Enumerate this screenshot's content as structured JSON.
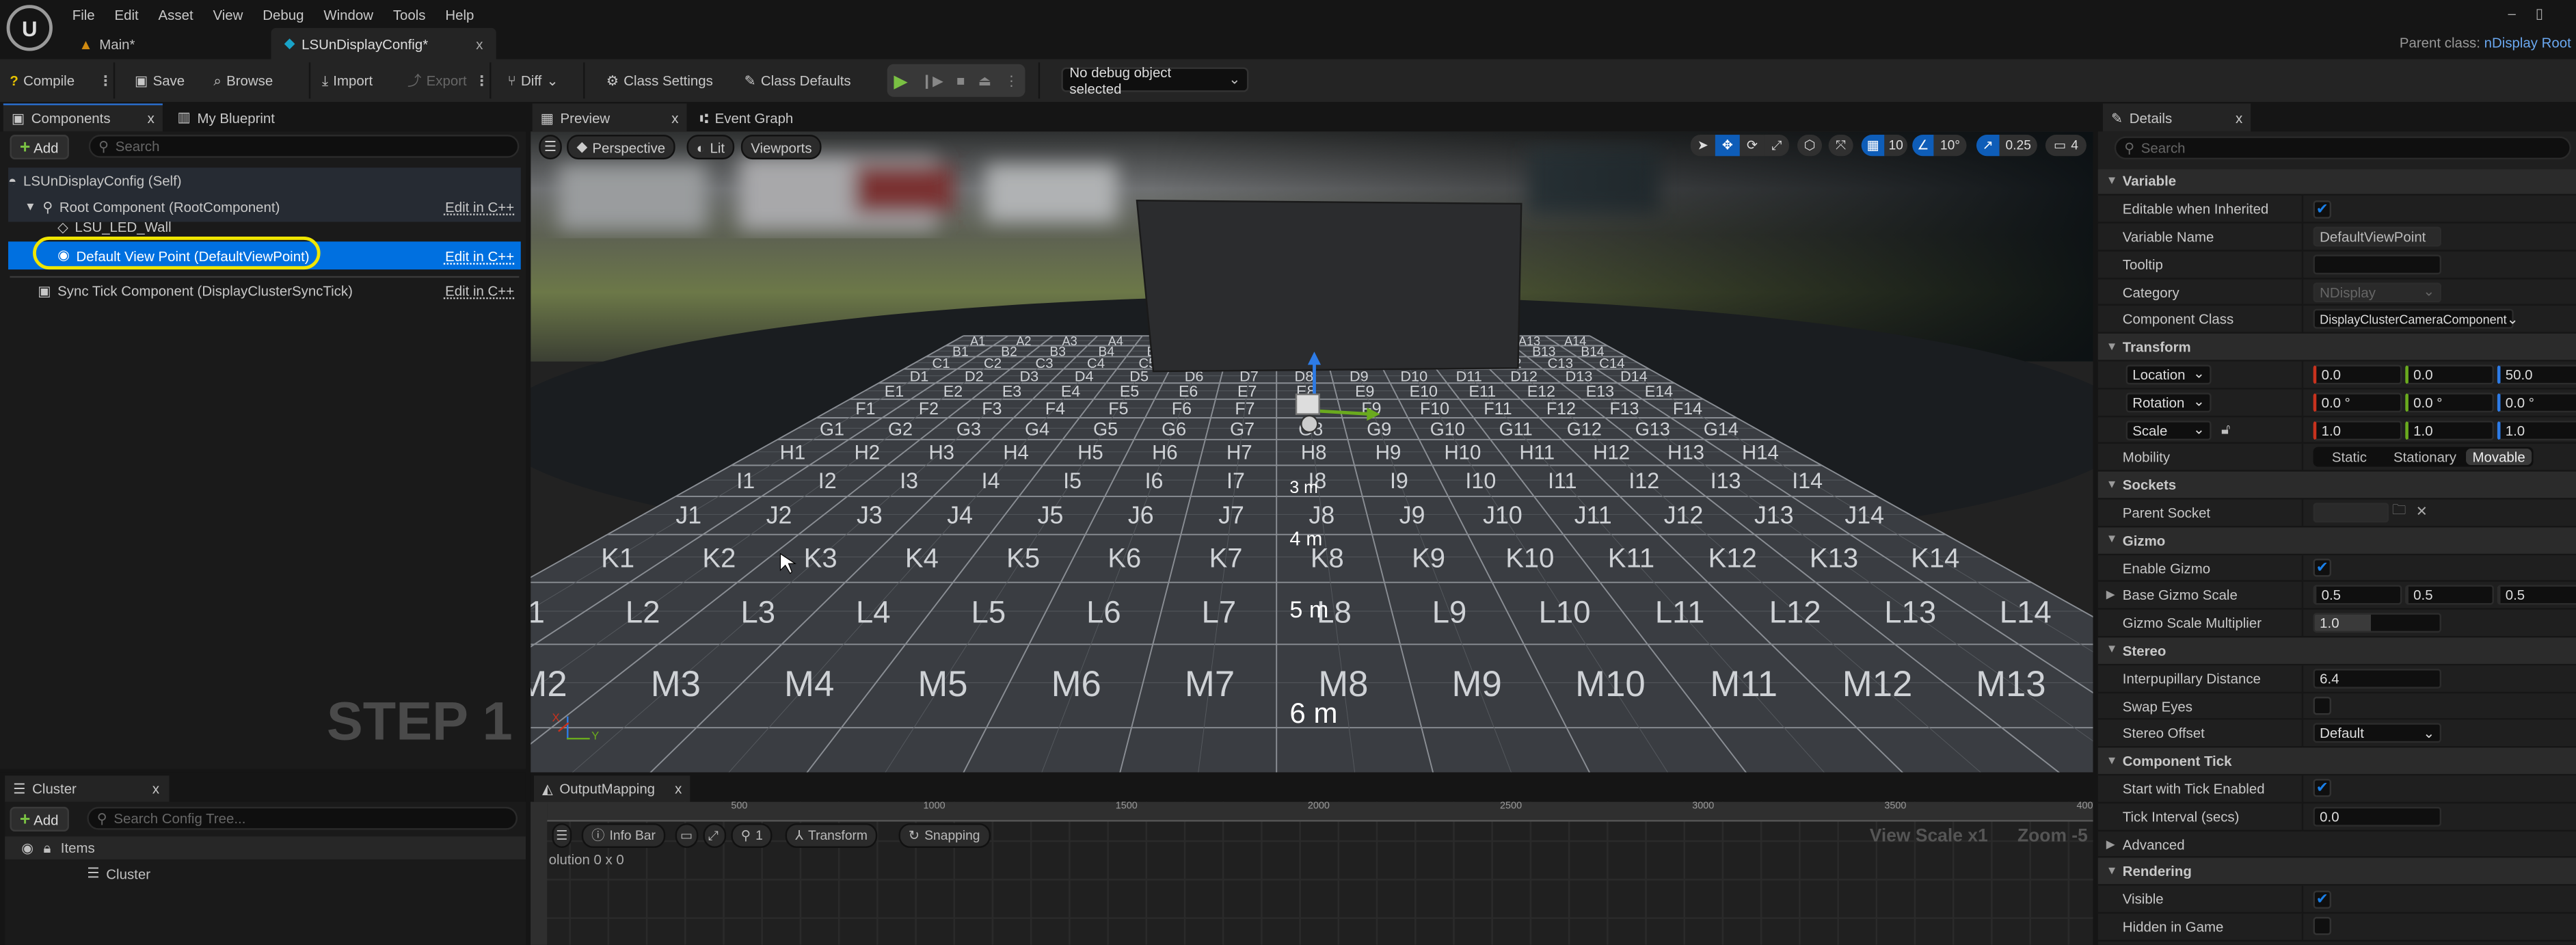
{
  "menu": [
    "File",
    "Edit",
    "Asset",
    "View",
    "Debug",
    "Window",
    "Tools",
    "Help"
  ],
  "doc_tabs": [
    {
      "label": "Main*"
    },
    {
      "label": "LSUnDisplayConfig*",
      "close": "x"
    }
  ],
  "parent_class": {
    "label": "Parent class:",
    "value": "nDisplay Root"
  },
  "toolbar": {
    "compile": "Compile",
    "save": "Save",
    "browse": "Browse",
    "import": "Import",
    "export": "Export",
    "diff": "Diff",
    "class_settings": "Class Settings",
    "class_defaults": "Class Defaults",
    "debug_object": "No debug object selected"
  },
  "components_panel": {
    "tab": "Components",
    "tab2": "My Blueprint",
    "add": "Add",
    "search_placeholder": "Search",
    "items": [
      {
        "label": "LSUnDisplayConfig (Self)"
      },
      {
        "label": "Root Component (RootComponent)",
        "edit": "Edit in C++"
      },
      {
        "label": "LSU_LED_Wall"
      },
      {
        "label": "Default View Point (DefaultViewPoint)",
        "edit": "Edit in C++",
        "selected": true
      },
      {
        "label": "Sync Tick Component (DisplayClusterSyncTick)",
        "edit": "Edit in C++"
      }
    ],
    "step_label": "STEP 1",
    "highlight_color": "#f0e600",
    "selection_color": "#0070e0"
  },
  "viewport": {
    "tab": "Preview",
    "tab2": "Event Graph",
    "perspective": "Perspective",
    "lit": "Lit",
    "viewports": "Viewports",
    "grid_snap": "10",
    "angle_snap": "10°",
    "scale_snap": "0.25",
    "camera_speed": "4",
    "floor": {
      "rows": [
        "A",
        "B",
        "C",
        "D",
        "E",
        "F",
        "G",
        "H",
        "I",
        "J",
        "K",
        "L",
        "M"
      ],
      "columns": 14,
      "distance_markers": [
        "3 m",
        "4 m",
        "5 m",
        "6 m"
      ]
    },
    "axis": {
      "x": "X",
      "y": "Y"
    }
  },
  "cluster_panel": {
    "tab": "Cluster",
    "add": "Add",
    "search_placeholder": "Search Config Tree...",
    "header": "Items",
    "items": [
      "Cluster"
    ]
  },
  "output_mapping": {
    "tab": "OutputMapping",
    "ruler": [
      "500",
      "1000",
      "1500",
      "2000",
      "2500",
      "3000",
      "3500",
      "400"
    ],
    "info_bar": "Info Bar",
    "zoom_value": "1",
    "transform": "Transform",
    "snapping": "Snapping",
    "resolution": "olution 0 x 0",
    "view_scale": "View Scale x1",
    "zoom": "Zoom -5"
  },
  "details": {
    "tab": "Details",
    "search_placeholder": "Search",
    "variable": {
      "title": "Variable",
      "editable_label": "Editable when Inherited",
      "editable": true,
      "name_label": "Variable Name",
      "name": "DefaultViewPoint",
      "tooltip_label": "Tooltip",
      "tooltip": "",
      "category_label": "Category",
      "category": "NDisplay",
      "class_label": "Component Class",
      "class": "DisplayClusterCameraComponent"
    },
    "transform": {
      "title": "Transform",
      "location_label": "Location",
      "location": [
        "0.0",
        "0.0",
        "50.0"
      ],
      "rotation_label": "Rotation",
      "rotation": [
        "0.0 °",
        "0.0 °",
        "0.0 °"
      ],
      "scale_label": "Scale",
      "scale": [
        "1.0",
        "1.0",
        "1.0"
      ],
      "mobility_label": "Mobility",
      "mobility": [
        "Static",
        "Stationary",
        "Movable"
      ],
      "mobility_selected": "Movable"
    },
    "sockets": {
      "title": "Sockets",
      "parent_label": "Parent Socket"
    },
    "gizmo": {
      "title": "Gizmo",
      "enable_label": "Enable Gizmo",
      "enable": true,
      "base_label": "Base Gizmo Scale",
      "base": [
        "0.5",
        "0.5",
        "0.5"
      ],
      "mult_label": "Gizmo Scale Multiplier",
      "mult": "1.0"
    },
    "stereo": {
      "title": "Stereo",
      "ipd_label": "Interpupillary Distance",
      "ipd": "6.4",
      "swap_label": "Swap Eyes",
      "swap": false,
      "offset_label": "Stereo Offset",
      "offset": "Default"
    },
    "tick": {
      "title": "Component Tick",
      "start_label": "Start with Tick Enabled",
      "start": true,
      "interval_label": "Tick Interval (secs)",
      "interval": "0.0",
      "advanced": "Advanced"
    },
    "rendering": {
      "title": "Rendering",
      "visible_label": "Visible",
      "visible": true,
      "hidden_label": "Hidden in Game",
      "hidden": false
    }
  },
  "colors": {
    "axis_x": "#c8321e",
    "axis_y": "#6aaa1e",
    "axis_z": "#2d7be6",
    "accent": "#0e5db8",
    "play": "#7ac143"
  }
}
